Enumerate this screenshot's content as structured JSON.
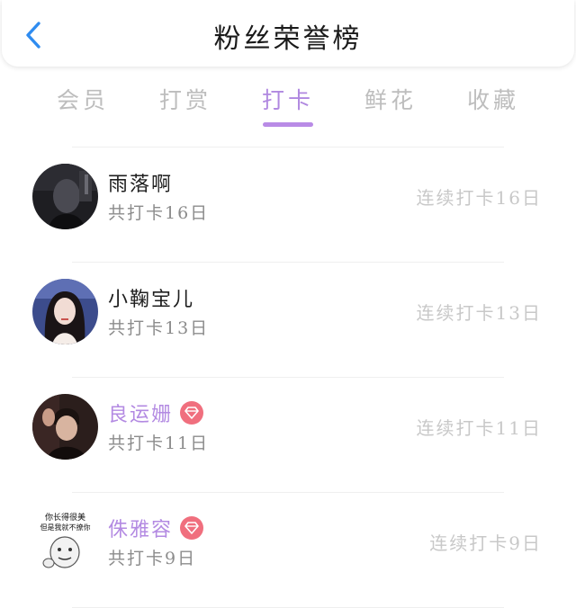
{
  "header": {
    "title": "粉丝荣誉榜",
    "back_icon": "chevron-left-icon",
    "accent_color": "#2f8cf0"
  },
  "tabs": [
    {
      "label": "会员",
      "active": false
    },
    {
      "label": "打赏",
      "active": false
    },
    {
      "label": "打卡",
      "active": true
    },
    {
      "label": "鲜花",
      "active": false
    },
    {
      "label": "收藏",
      "active": false
    }
  ],
  "colors": {
    "active_tab": "#b088e0",
    "vip_name": "#b38ae2",
    "vip_badge": "#f06f7e"
  },
  "fans": [
    {
      "name": "雨落啊",
      "vip": false,
      "total": "共打卡16日",
      "streak": "连续打卡16日",
      "avatar_icon": "dark-portrait-avatar"
    },
    {
      "name": "小鞠宝儿",
      "vip": false,
      "total": "共打卡13日",
      "streak": "连续打卡13日",
      "avatar_icon": "girl-portrait-avatar"
    },
    {
      "name": "良运姗",
      "vip": true,
      "vip_icon": "diamond-icon",
      "total": "共打卡11日",
      "streak": "连续打卡11日",
      "avatar_icon": "man-portrait-avatar"
    },
    {
      "name": "侏雅容",
      "vip": true,
      "vip_icon": "diamond-icon",
      "total": "共打卡9日",
      "streak": "连续打卡9日",
      "avatar_icon": "meme-face-avatar",
      "avatar_text": [
        "你长得很美",
        "但是我就不撩你"
      ]
    }
  ]
}
